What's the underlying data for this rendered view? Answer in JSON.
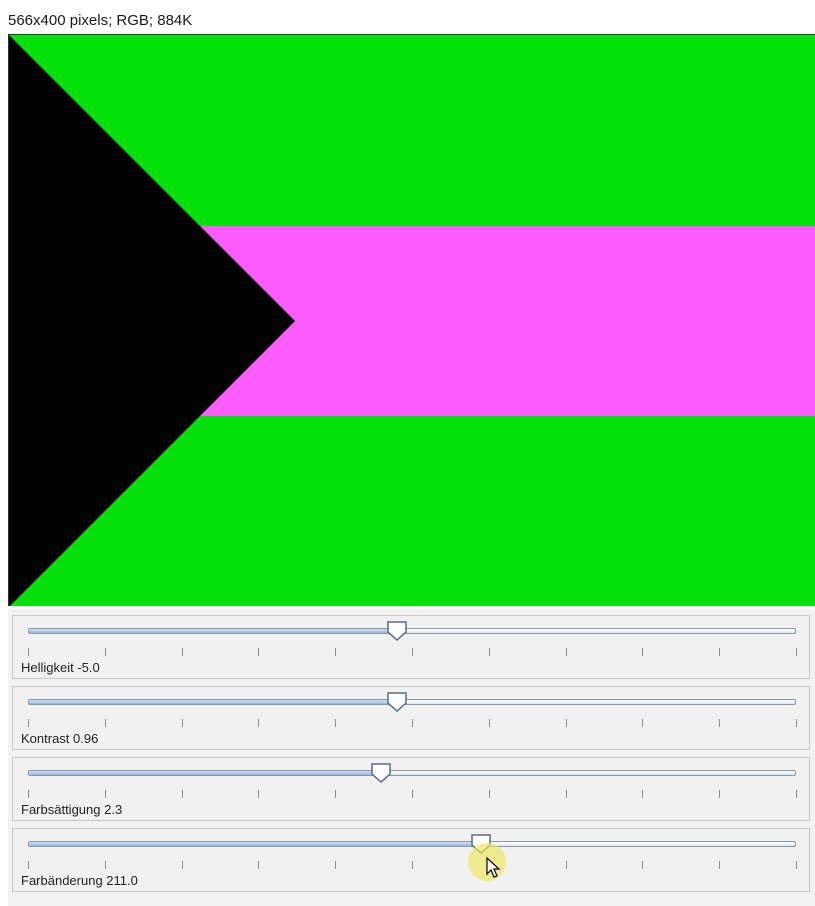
{
  "image_info": "566x400 pixels; RGB; 884K",
  "flag_colors": {
    "green": "#03e10b",
    "pink": "#fc5cfc",
    "black": "#000000"
  },
  "sliders": [
    {
      "label": "Helligkeit -5.0",
      "position": 0.48,
      "ticks": 11
    },
    {
      "label": "Kontrast 0.96",
      "position": 0.48,
      "ticks": 11
    },
    {
      "label": "Farbsättigung 2.3",
      "position": 0.46,
      "ticks": 11
    },
    {
      "label": "Farbänderung 211.0",
      "position": 0.59,
      "ticks": 11
    }
  ],
  "colors": {
    "track_border": "#8a97a8",
    "thumb_fill": "#ffffff",
    "thumb_border": "#5a6b80"
  }
}
